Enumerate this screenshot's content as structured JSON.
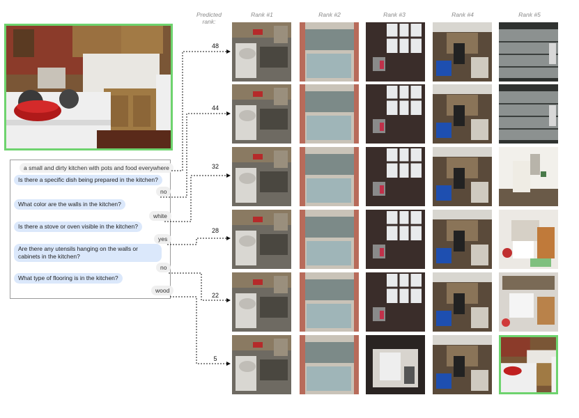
{
  "header": {
    "predicted_rank_line1": "Predicted",
    "predicted_rank_line2": "rank:",
    "rank_labels": [
      "Rank #1",
      "Rank #2",
      "Rank #3",
      "Rank #4",
      "Rank #5"
    ]
  },
  "dialog": {
    "caption": "a small and dirty kitchen with pots and food everywhere",
    "turns": [
      {
        "question": "Is there a specific dish being prepared in the kitchen?",
        "answer": "no"
      },
      {
        "question": "What color are the walls in the kitchen?",
        "answer": "white"
      },
      {
        "question": "Is there a stove or oven visible in the kitchen?",
        "answer": "yes"
      },
      {
        "question": "Are there any utensils hanging on the walls or cabinets in the kitchen?",
        "answer": "no"
      },
      {
        "question": "What type of flooring is in the kitchen?",
        "answer": "wood"
      }
    ]
  },
  "predicted_ranks": [
    "48",
    "44",
    "32",
    "28",
    "22",
    "5"
  ],
  "colors": {
    "highlight": "#6ed36e",
    "question_bubble": "#dbe8fb",
    "answer_bubble": "#efefef"
  }
}
